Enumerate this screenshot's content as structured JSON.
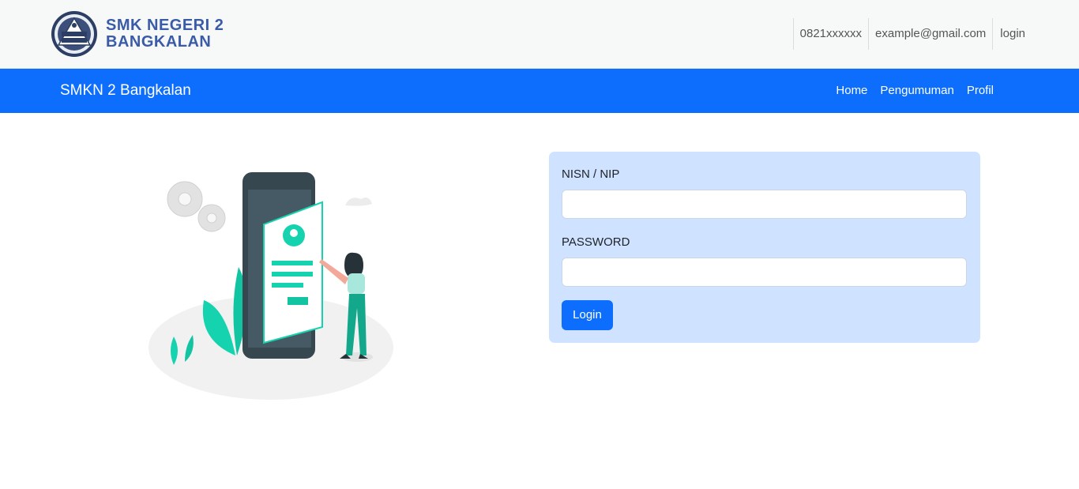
{
  "header": {
    "logo_title_line1": "SMK NEGERI 2",
    "logo_title_line2": "BANGKALAN",
    "logo_icon": "school-emblem-icon",
    "contacts": {
      "phone": "0821xxxxxx",
      "email": "example@gmail.com",
      "login_link": "login"
    }
  },
  "navbar": {
    "brand": "SMKN 2 Bangkalan",
    "links": [
      "Home",
      "Pengumuman",
      "Profil"
    ]
  },
  "illustration": {
    "icon": "mobile-login-illustration"
  },
  "login_form": {
    "username_label": "NISN / NIP",
    "username_value": "",
    "password_label": "PASSWORD",
    "password_value": "",
    "submit_label": "Login"
  },
  "colors": {
    "primary": "#0d6efd",
    "card_bg": "#cfe2ff",
    "brand_text": "#3a5ba8",
    "illustration_accent": "#16d3b0"
  }
}
